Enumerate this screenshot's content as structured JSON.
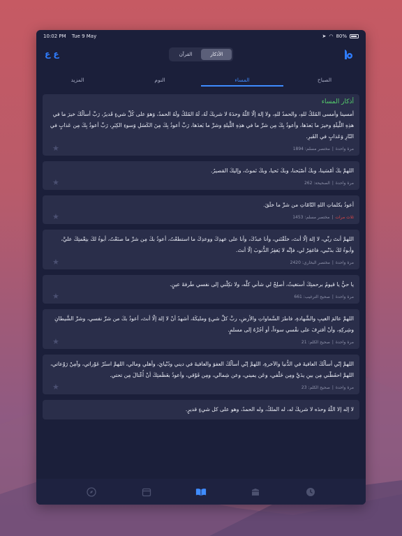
{
  "status": {
    "time": "10:02 PM",
    "date": "Tue 9 May",
    "battery": "80%"
  },
  "header": {
    "left_icon_label": "ع ع",
    "segments": [
      "الأذكار",
      "القرآن"
    ],
    "active_segment": "الأذكار"
  },
  "tabs": [
    "المزيد",
    "النوم",
    "المساء",
    "الصباح"
  ],
  "active_tab": "المساء",
  "colors": {
    "accent": "#3f8cff",
    "title_green": "#56d16c",
    "red": "#e04848"
  },
  "cards": [
    {
      "title": "أذكار المساء",
      "text": "أمسينا وأمسى المُلكُ للهِ، والحمدُ للهِ، ولا إلهَ إلّا اللّهُ وحدَهُ لا شريكَ لَهُ، لَهُ المُلكُ ولَهُ الحمدُ، وَهوَ على كُلِّ شيءٍ قَديرٌ، رَبِّ أسألُكَ خيرَ ما في هذِهِ اللَّيلَةِ وخيرَ ما بَعدَها، وأعوذُ بِكَ مِن شرِّ ما في هذِهِ اللَّيلةِ وشرِّ ما بَعدَها، رَبِّ أعوذُ بِكَ مِنَ الكَسَلِ وَسوءِ الكِبَرِ، رَبِّ أعوذُ بِكَ مِن عَذابٍ في النّارِ وَعَذابٍ في القَبرِ.",
      "repeat": "مرة واحدة",
      "source": "مختصر مسلم: 1894",
      "red": false
    },
    {
      "title": "",
      "text": "اللهمَّ بكَ أمْسَينا، وبكَ أصْبَحنا، وبكَ نَحيا، وبكَ نَموتُ، وإليكَ المَصيرُ.",
      "repeat": "مرة واحدة",
      "source": "الصحيحة: 262",
      "red": false
    },
    {
      "title": "",
      "text": "أعوذُ بكلماتِ اللهِ التّامّاتِ من شرِّ ما خلَقَ.",
      "repeat": "ثلاث مرات",
      "source": "مختصر مسلم: 1453",
      "red": true
    },
    {
      "title": "",
      "text": "اللهمَّ أنتَ ربِّي، لا إلهَ إلّا أنتَ، خلَقْتَني، وأنا عبدُكَ، وأنا على عهدِكَ ووعدِكَ ما استطعْتُ، أعوذُ بكَ مِن شرِّ ما صنَعْتُ، أبوءُ لكَ بنِعْمتِكَ عليَّ، وأبوءُ لكَ بذَنْبي، فاغفِرْ لي، فإنَّه لا يَغفِرُ الذُّنوبَ إلّا أنتَ.",
      "repeat": "مرة واحدة",
      "source": "مختصر البخاري: 2420",
      "red": false
    },
    {
      "title": "",
      "text": "يا حيُّ يا قيومُ برحمتِكَ أستغيثُ، أصلِحْ لي شأني كلَّه، ولا تكِلْني إلى نفسي طَرفةَ عينٍ.",
      "repeat": "مرة واحدة",
      "source": "صحيح الترغيب: 661",
      "red": false
    },
    {
      "title": "",
      "text": "اللهمَّ عالمَ الغيبِ والشَّهادةِ، فاطرَ السَّماواتِ والأرضِ، ربَّ كلِّ شيءٍ ومليكَهُ، أشهدُ أنْ لا إلهَ إلّا أنتَ، أعوذُ بكَ من شرِّ نفسي، وشرِّ الشَّيطانِ وشِركِهِ، وأنْ أقترِفَ على نفْسي سوءاً، أو أجُرَّهُ إلى مسلمٍ.",
      "repeat": "مرة واحدة",
      "source": "صحيح الكلم: 21",
      "red": false
    },
    {
      "title": "",
      "text": "اللهمَّ إنّي أسألُكَ العافيةَ في الدُّنيا والآخرةِ، اللهمَّ إنّي أسألُكَ العفوَ والعافيةَ في ديني ودُنْيايَ، وأهلي ومالي، اللهمَّ استُرْ عَوْراتي، وآمِنْ رَوْعاتي، اللهمَّ احفَظْني مِن بينِ يدَيَّ ومِن خَلْفي، وعَن يميني، وعن شِمالي، ومِن فَوْقي، وأعوذُ بعَظَمتِكَ أنْ أُغْتالَ مِن تحتي.",
      "repeat": "مرة واحدة",
      "source": "صحيح الكلم: 23",
      "red": false
    },
    {
      "title": "",
      "text": "لا إله إلا اللّهُ وحدَه لا شريكَ له، له الملكُ، وله الحمدُ، وهو على كل شيءٍ قديرٍ.",
      "repeat": "",
      "source": "",
      "red": false
    }
  ],
  "bottom_nav": [
    "compass-icon",
    "calendar-icon",
    "book-icon",
    "kaaba-icon",
    "clock-icon"
  ],
  "bottom_nav_active": "book-icon"
}
